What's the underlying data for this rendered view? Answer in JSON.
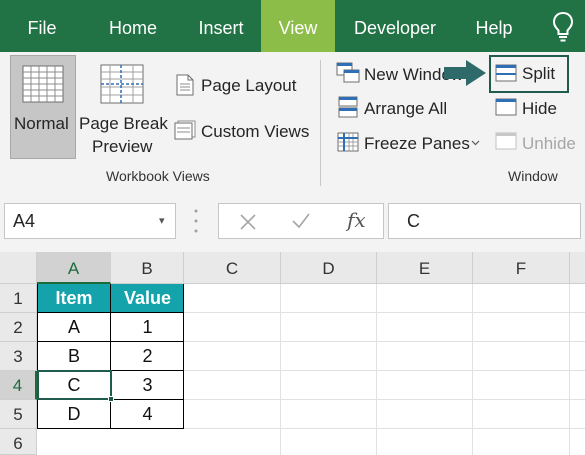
{
  "ribbon_tabs": {
    "file": "File",
    "home": "Home",
    "insert": "Insert",
    "view": "View",
    "developer": "Developer",
    "help": "Help"
  },
  "active_tab": "View",
  "tell_me_icon": "lightbulb-icon",
  "workbook_views": {
    "normal": "Normal",
    "page_break_line1": "Page Break",
    "page_break_line2": "Preview",
    "page_layout": "Page Layout",
    "custom_views": "Custom Views",
    "group_label": "Workbook Views"
  },
  "window_group": {
    "new_window": "New Window",
    "arrange_all": "Arrange All",
    "freeze_panes": "Freeze Panes",
    "split": "Split",
    "hide": "Hide",
    "unhide": "Unhide",
    "group_label": "Window"
  },
  "formula_bar": {
    "name_box": "A4",
    "cancel_icon": "x-icon",
    "enter_icon": "checkmark-icon",
    "fx_label": "fx",
    "value": "C"
  },
  "grid": {
    "columns": [
      "A",
      "B",
      "C",
      "D",
      "E",
      "F"
    ],
    "rows": [
      "1",
      "2",
      "3",
      "4",
      "5",
      "6"
    ],
    "selected_column": "A",
    "selected_row": "4",
    "table": {
      "headers": [
        "Item",
        "Value"
      ],
      "rows": [
        [
          "A",
          "1"
        ],
        [
          "B",
          "2"
        ],
        [
          "C",
          "3"
        ],
        [
          "D",
          "4"
        ]
      ]
    }
  },
  "colors": {
    "ribbon_green": "#217346",
    "active_tab": "#8cbd49",
    "table_header": "#14a3aa",
    "selection": "#1f5c4d"
  }
}
